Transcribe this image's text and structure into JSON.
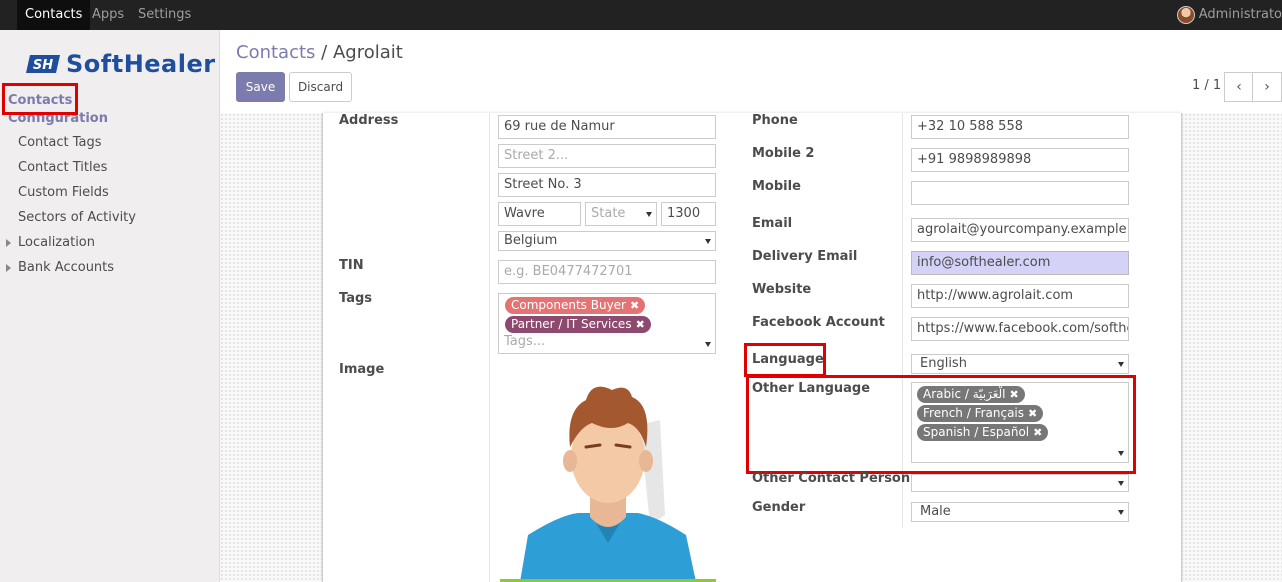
{
  "topbar": {
    "menu": [
      "Contacts",
      "Apps",
      "Settings"
    ],
    "user": "Administrato"
  },
  "sidebar": {
    "logo_mark": "SH",
    "logo_text": "SoftHealer",
    "heading_contacts": "Contacts",
    "heading_configuration": "Configuration",
    "items": [
      "Contact Tags",
      "Contact Titles",
      "Custom Fields",
      "Sectors of Activity",
      "Localization",
      "Bank Accounts"
    ]
  },
  "breadcrumb": {
    "parent": "Contacts",
    "sep": "/",
    "current": "Agrolait"
  },
  "buttons": {
    "save": "Save",
    "discard": "Discard"
  },
  "pager": {
    "value": "1 / 1",
    "prev": "‹",
    "next": "›"
  },
  "form": {
    "labels": {
      "address": "Address",
      "tin": "TIN",
      "tags": "Tags",
      "image": "Image",
      "phone": "Phone",
      "mobile2": "Mobile 2",
      "mobile": "Mobile",
      "email": "Email",
      "delivery_email": "Delivery Email",
      "website": "Website",
      "facebook": "Facebook Account",
      "language": "Language",
      "other_language": "Other Language",
      "other_contact": "Other Contact Person",
      "gender": "Gender"
    },
    "address": {
      "street": "69 rue de Namur",
      "street2_placeholder": "Street 2...",
      "street_no": "Street No. 3",
      "city": "Wavre",
      "state_placeholder": "State",
      "zip": "1300",
      "country": "Belgium"
    },
    "tin_placeholder": "e.g. BE0477472701",
    "tags": {
      "items": [
        {
          "label": "Components Buyer",
          "color": "#e57373"
        },
        {
          "label": "Partner / IT Services",
          "color": "#8d4a6e"
        }
      ],
      "placeholder": "Tags..."
    },
    "phone": "+32 10 588 558",
    "mobile2": "+91 9898989898",
    "mobile": "",
    "email": "agrolait@yourcompany.example.com",
    "delivery_email": "info@softhealer.com",
    "website": "http://www.agrolait.com",
    "facebook": "https://www.facebook.com/softhealer",
    "language": "English",
    "other_languages": [
      "Arabic / الْعَرَبيّة",
      "French / Français",
      "Spanish / Español"
    ],
    "other_contact": "",
    "gender": "Male"
  },
  "colors": {
    "brand": "#7c7bad",
    "highlight": "#e00000",
    "tag_grey": "#777777"
  }
}
